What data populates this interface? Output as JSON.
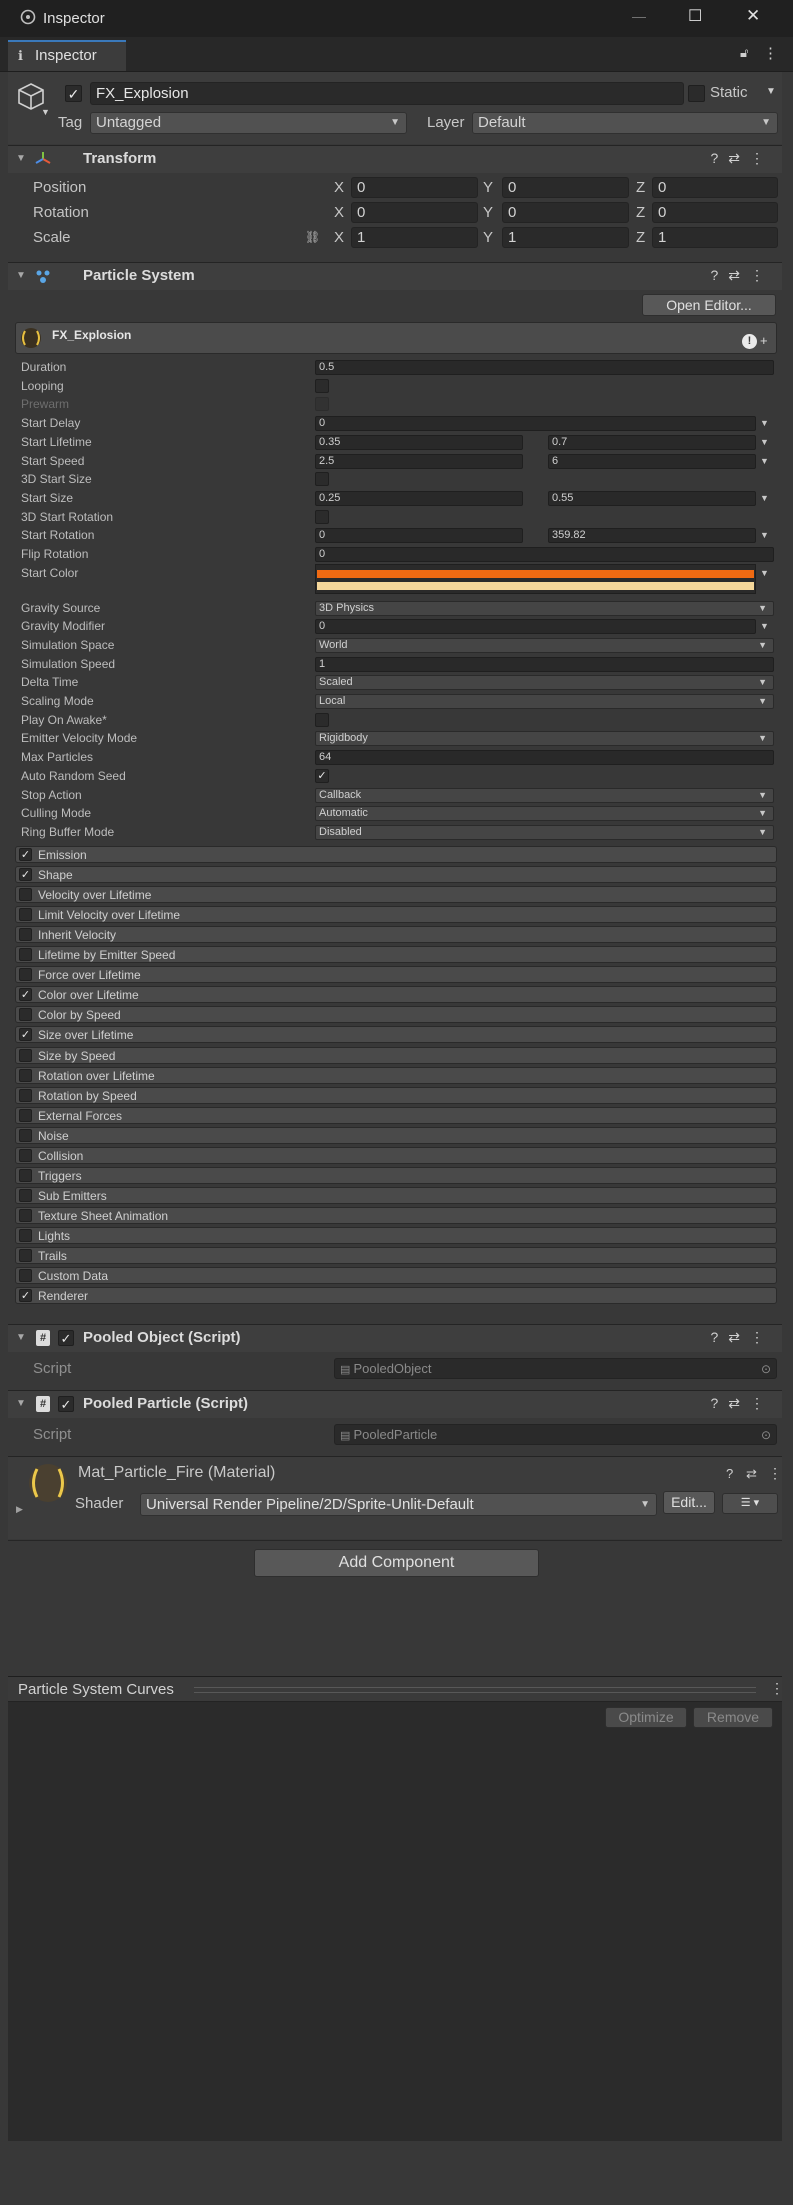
{
  "window": {
    "title": "Inspector",
    "controls": [
      "—",
      "☐",
      "✕"
    ]
  },
  "tab": {
    "label": "Inspector"
  },
  "gameobject": {
    "name": "FX_Explosion",
    "static_label": "Static",
    "tag_label": "Tag",
    "tag_value": "Untagged",
    "layer_label": "Layer",
    "layer_value": "Default"
  },
  "transform": {
    "title": "Transform",
    "rows": [
      {
        "label": "Position",
        "x": "0",
        "y": "0",
        "z": "0"
      },
      {
        "label": "Rotation",
        "x": "0",
        "y": "0",
        "z": "0"
      },
      {
        "label": "Scale",
        "x": "1",
        "y": "1",
        "z": "1"
      }
    ],
    "axis": {
      "x": "X",
      "y": "Y",
      "z": "Z"
    }
  },
  "particle_system": {
    "title": "Particle System",
    "open_editor": "Open Editor...",
    "sub_title": "FX_Explosion",
    "props": [
      {
        "label": "Duration",
        "kind": "field",
        "v1": "0.5"
      },
      {
        "label": "Looping",
        "kind": "check",
        "checked": false
      },
      {
        "label": "Prewarm",
        "kind": "check",
        "checked": false,
        "disabled": true
      },
      {
        "label": "Start Delay",
        "kind": "field",
        "v1": "0",
        "arrow": true
      },
      {
        "label": "Start Lifetime",
        "kind": "two",
        "v1": "0.35",
        "v2": "0.7",
        "arrow": true
      },
      {
        "label": "Start Speed",
        "kind": "two",
        "v1": "2.5",
        "v2": "6",
        "arrow": true
      },
      {
        "label": "3D Start Size",
        "kind": "check",
        "checked": false
      },
      {
        "label": "Start Size",
        "kind": "two",
        "v1": "0.25",
        "v2": "0.55",
        "arrow": true
      },
      {
        "label": "3D Start Rotation",
        "kind": "check",
        "checked": false
      },
      {
        "label": "Start Rotation",
        "kind": "two",
        "v1": "0",
        "v2": "359.82",
        "arrow": true
      },
      {
        "label": "Flip Rotation",
        "kind": "field",
        "v1": "0"
      },
      {
        "label": "Start Color",
        "kind": "color",
        "arrow": true
      },
      {
        "label": "Gravity Source",
        "kind": "drop",
        "v1": "3D Physics"
      },
      {
        "label": "Gravity Modifier",
        "kind": "field",
        "v1": "0",
        "arrow": true
      },
      {
        "label": "Simulation Space",
        "kind": "drop",
        "v1": "World"
      },
      {
        "label": "Simulation Speed",
        "kind": "field",
        "v1": "1"
      },
      {
        "label": "Delta Time",
        "kind": "drop",
        "v1": "Scaled"
      },
      {
        "label": "Scaling Mode",
        "kind": "drop",
        "v1": "Local"
      },
      {
        "label": "Play On Awake*",
        "kind": "check",
        "checked": false
      },
      {
        "label": "Emitter Velocity Mode",
        "kind": "drop",
        "v1": "Rigidbody"
      },
      {
        "label": "Max Particles",
        "kind": "field",
        "v1": "64"
      },
      {
        "label": "Auto Random Seed",
        "kind": "check",
        "checked": true
      },
      {
        "label": "Stop Action",
        "kind": "drop",
        "v1": "Callback"
      },
      {
        "label": "Culling Mode",
        "kind": "drop",
        "v1": "Automatic"
      },
      {
        "label": "Ring Buffer Mode",
        "kind": "drop",
        "v1": "Disabled"
      }
    ],
    "start_color": {
      "top": "#f06a12",
      "bottom": "#f5d79a"
    },
    "modules": [
      {
        "label": "Emission",
        "checked": true
      },
      {
        "label": "Shape",
        "checked": true
      },
      {
        "label": "Velocity over Lifetime",
        "checked": false
      },
      {
        "label": "Limit Velocity over Lifetime",
        "checked": false
      },
      {
        "label": "Inherit Velocity",
        "checked": false
      },
      {
        "label": "Lifetime by Emitter Speed",
        "checked": false
      },
      {
        "label": "Force over Lifetime",
        "checked": false
      },
      {
        "label": "Color over Lifetime",
        "checked": true
      },
      {
        "label": "Color by Speed",
        "checked": false
      },
      {
        "label": "Size over Lifetime",
        "checked": true
      },
      {
        "label": "Size by Speed",
        "checked": false
      },
      {
        "label": "Rotation over Lifetime",
        "checked": false
      },
      {
        "label": "Rotation by Speed",
        "checked": false
      },
      {
        "label": "External Forces",
        "checked": false
      },
      {
        "label": "Noise",
        "checked": false
      },
      {
        "label": "Collision",
        "checked": false
      },
      {
        "label": "Triggers",
        "checked": false
      },
      {
        "label": "Sub Emitters",
        "checked": false
      },
      {
        "label": "Texture Sheet Animation",
        "checked": false
      },
      {
        "label": "Lights",
        "checked": false
      },
      {
        "label": "Trails",
        "checked": false
      },
      {
        "label": "Custom Data",
        "checked": false
      },
      {
        "label": "Renderer",
        "checked": true
      }
    ]
  },
  "pooled_object": {
    "title": "Pooled Object (Script)",
    "script_label": "Script",
    "script_value": "PooledObject"
  },
  "pooled_particle": {
    "title": "Pooled Particle (Script)",
    "script_label": "Script",
    "script_value": "PooledParticle"
  },
  "material": {
    "title": "Mat_Particle_Fire (Material)",
    "shader_label": "Shader",
    "shader_value": "Universal Render Pipeline/2D/Sprite-Unlit-Default",
    "edit_label": "Edit..."
  },
  "add_component": "Add Component",
  "curves": {
    "title": "Particle System Curves",
    "optimize": "Optimize",
    "remove": "Remove"
  },
  "colors": {
    "bg": "#383838",
    "header": "#3e3e3e",
    "field": "#2a2a2a",
    "accent_tab": "#3c5d8a"
  }
}
